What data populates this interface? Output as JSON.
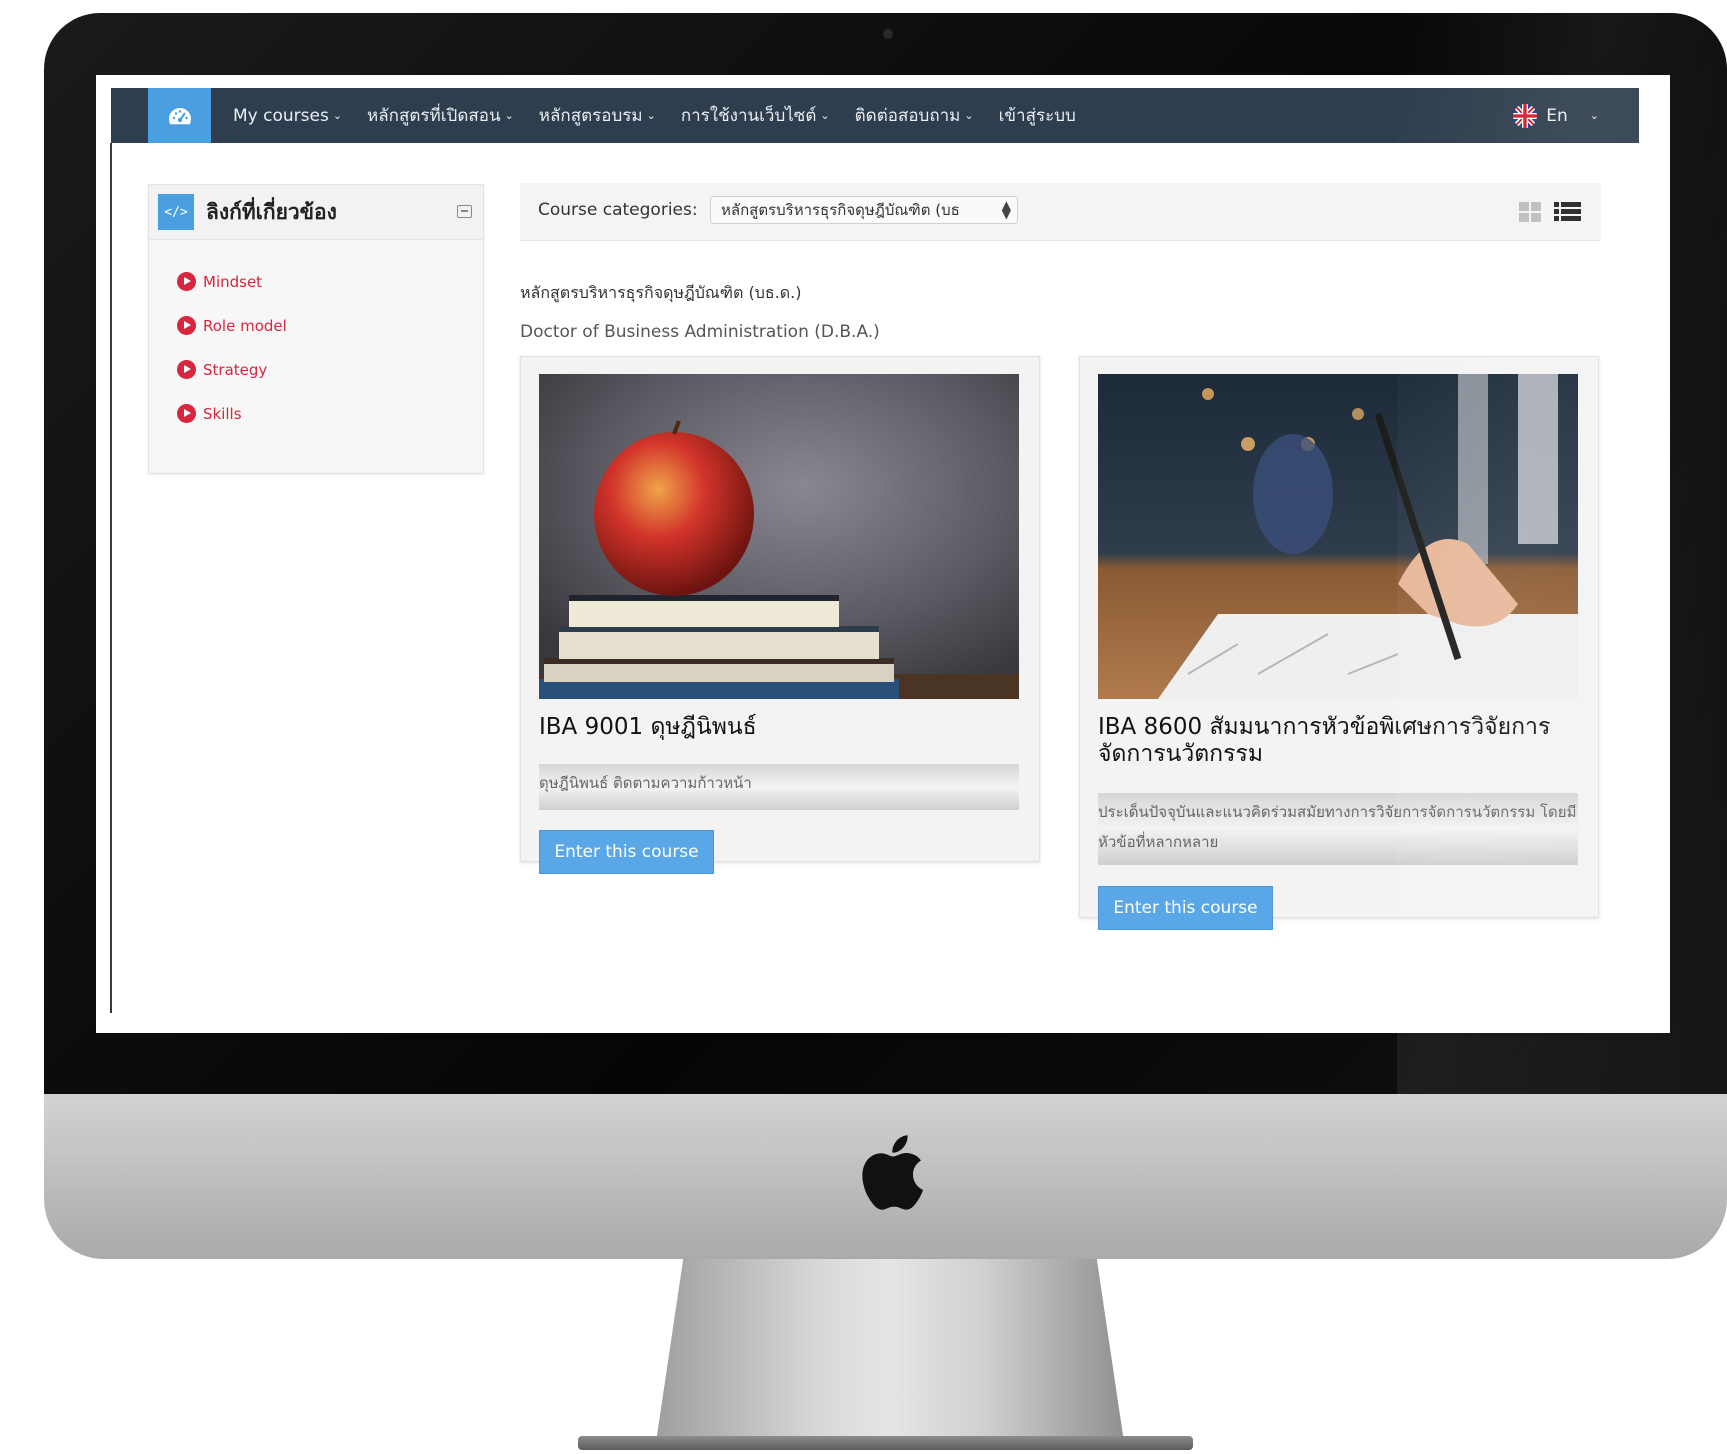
{
  "navbar": {
    "items": [
      {
        "label": "My courses",
        "has_dropdown": true
      },
      {
        "label": "หลักสูตรที่เปิดสอน",
        "has_dropdown": true
      },
      {
        "label": "หลักสูตรอบรม",
        "has_dropdown": true
      },
      {
        "label": "การใช้งานเว็บไซต์",
        "has_dropdown": true
      },
      {
        "label": "ติดต่อสอบถาม",
        "has_dropdown": true
      },
      {
        "label": "เข้าสู่ระบบ",
        "has_dropdown": false
      }
    ],
    "language": "En",
    "home_icon": "dashboard-icon",
    "accent_color": "#4a9fe0",
    "bar_color": "#2f3e4e"
  },
  "sidebar": {
    "block_title": "ลิงก์ที่เกี่ยวข้อง",
    "block_icon": "code-icon",
    "links": [
      {
        "label": "Mindset"
      },
      {
        "label": "Role model"
      },
      {
        "label": "Strategy"
      },
      {
        "label": "Skills"
      }
    ],
    "link_color": "#d7263d"
  },
  "catbar": {
    "label": "Course categories:",
    "selected": "หลักสูตรบริหารธุรกิจดุษฎีบัณฑิต (บธ"
  },
  "category": {
    "name_th": "หลักสูตรบริหารธุรกิจดุษฎีบัณฑิต (บธ.ด.)",
    "name_en": "Doctor of Business Administration (D.B.A.)"
  },
  "courses": [
    {
      "title": "IBA 9001 ดุษฎีนิพนธ์",
      "summary": "ดุษฎีนิพนธ์ ติดตามความก้าวหน้า",
      "button": "Enter this course",
      "image": "apple-on-books-photo"
    },
    {
      "title": "IBA 8600 สัมมนาการหัวข้อพิเศษการวิจัยการจัดการนวัตกรรม",
      "summary": "ประเด็นปัจจุบันและแนวคิดร่วมสมัยทางการวิจัยการจัดการนวัตกรรม โดยมีหัวข้อที่หลากหลาย",
      "button": "Enter this course",
      "image": "hand-writing-photo"
    }
  ],
  "device": {
    "logo": "apple-logo-icon"
  }
}
